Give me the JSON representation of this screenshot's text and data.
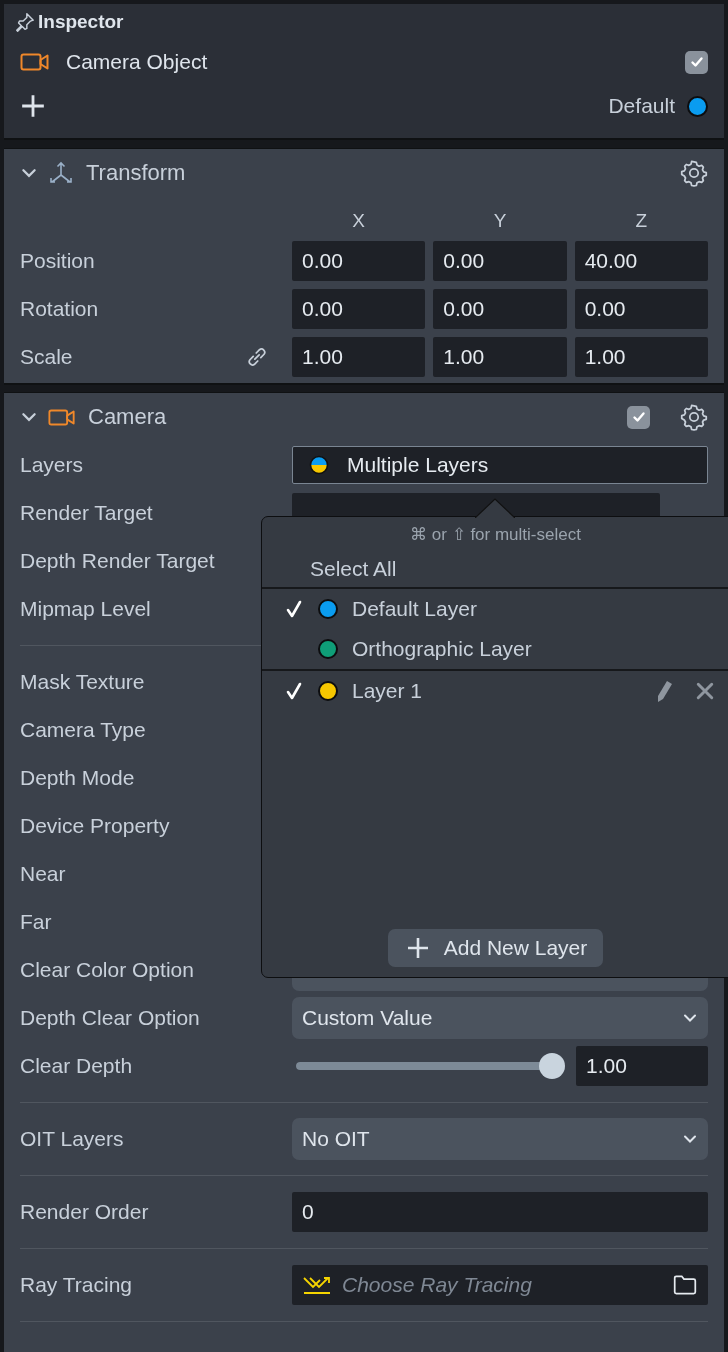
{
  "panel": {
    "title": "Inspector"
  },
  "object": {
    "name": "Camera Object",
    "enabled": true,
    "layer": {
      "name": "Default",
      "color": "#0a9cf0"
    }
  },
  "transform": {
    "title": "Transform",
    "expanded": true,
    "axes": [
      "X",
      "Y",
      "Z"
    ],
    "rows": [
      {
        "label": "Position",
        "values": [
          "0.00",
          "0.00",
          "40.00"
        ]
      },
      {
        "label": "Rotation",
        "values": [
          "0.00",
          "0.00",
          "0.00"
        ]
      },
      {
        "label": "Scale",
        "values": [
          "1.00",
          "1.00",
          "1.00"
        ],
        "kind": "linked"
      }
    ]
  },
  "camera": {
    "title": "Camera",
    "expanded": true,
    "enabled": true,
    "groups": [
      [
        {
          "kind": "layers",
          "label": "Layers",
          "value": "Multiple Layers"
        },
        {
          "kind": "asset",
          "label": "Render Target"
        },
        {
          "kind": "hidden",
          "label": "Depth Render Target"
        },
        {
          "kind": "hidden",
          "label": "Mipmap Level"
        }
      ],
      [
        {
          "kind": "hidden",
          "label": "Mask Texture"
        },
        {
          "kind": "hidden",
          "label": "Camera Type"
        },
        {
          "kind": "hidden",
          "label": "Depth Mode"
        },
        {
          "kind": "hidden",
          "label": "Device Property"
        },
        {
          "kind": "hidden",
          "label": "Near"
        },
        {
          "kind": "hidden",
          "label": "Far"
        },
        {
          "kind": "dropdown",
          "label": "Clear Color Option"
        },
        {
          "kind": "dropdown",
          "label": "Depth Clear Option",
          "value": "Custom Value"
        },
        {
          "kind": "slider",
          "label": "Clear Depth",
          "level": 1,
          "value": "1.00"
        }
      ],
      [
        {
          "kind": "dropdown",
          "label": "OIT Layers",
          "value": "No OIT"
        }
      ],
      [
        {
          "kind": "number",
          "label": "Render Order",
          "value": "0"
        }
      ],
      [
        {
          "kind": "file",
          "label": "Ray Tracing",
          "placeholder": "Choose Ray Tracing"
        }
      ]
    ]
  },
  "layers_popup": {
    "hint": "⌘ or ⇧ for multi-select",
    "select_all": "Select All",
    "builtin_layers": [
      {
        "name": "Default Layer",
        "color": "#0a9cf0",
        "checked": true
      },
      {
        "name": "Orthographic Layer",
        "color": "#0f9e78",
        "checked": false
      }
    ],
    "custom_layers": [
      {
        "name": "Layer 1",
        "color": "#f6c700",
        "checked": true
      }
    ],
    "add_button": "Add New Layer"
  }
}
